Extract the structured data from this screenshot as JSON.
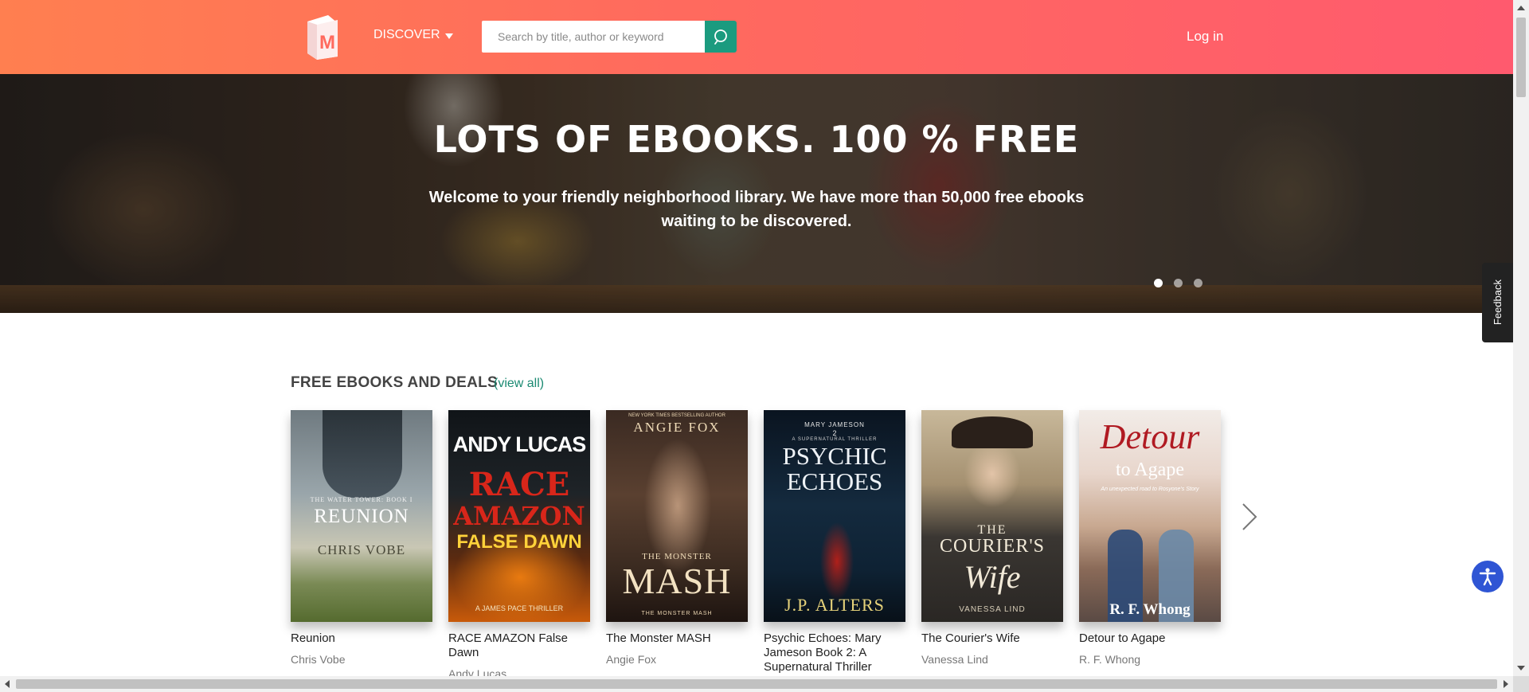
{
  "header": {
    "logo_letter": "M",
    "discover_label": "DISCOVER",
    "search_placeholder": "Search by title, author or keyword",
    "login_label": "Log in"
  },
  "hero": {
    "title": "LOTS OF EBOOKS. 100 % FREE",
    "subtitle": "Welcome to your friendly neighborhood library. We have more than 50,000 free ebooks waiting to be discovered.",
    "slides": 3,
    "active_slide": 1
  },
  "feedback_label": "Feedback",
  "section": {
    "title": "FREE EBOOKS AND DEALS",
    "view_all": "(view all)"
  },
  "books": [
    {
      "title": "Reunion",
      "author": "Chris Vobe",
      "cover": {
        "series": "THE WATER TOWER: BOOK I",
        "main": "REUNION",
        "author": "CHRIS VOBE"
      }
    },
    {
      "title": "RACE AMAZON False Dawn",
      "author": "Andy Lucas",
      "cover": {
        "author": "ANDY LUCAS",
        "line1": "RACE",
        "line2": "AMAZON",
        "line3": "FALSE DAWN",
        "tag": "A JAMES PACE THRILLER"
      }
    },
    {
      "title": "The Monster MASH",
      "author": "Angie Fox",
      "cover": {
        "top": "NEW YORK TIMES BESTSELLING AUTHOR",
        "author": "ANGIE FOX",
        "small": "THE MONSTER",
        "main": "MASH",
        "bottom": "THE MONSTER MASH"
      }
    },
    {
      "title": "Psychic Echoes: Mary Jameson Book 2: A Supernatural Thriller",
      "author": "",
      "cover": {
        "top": "MARY JAMESON",
        "num": "2",
        "sub": "A SUPERNATURAL THRILLER",
        "line1": "PSYCHIC",
        "line2": "ECHOES",
        "author": "J.P. ALTERS"
      }
    },
    {
      "title": "The Courier's Wife",
      "author": "Vanessa Lind",
      "cover": {
        "the": "THE",
        "line1": "COURIER'S",
        "line2": "Wife",
        "author": "VANESSA LIND"
      }
    },
    {
      "title": "Detour to Agape",
      "author": "R. F. Whong",
      "cover": {
        "line1": "Detour",
        "line2": "to Agape",
        "sub": "An unexpected road to Rosyone's Story",
        "author": "R. F. Whong"
      }
    }
  ],
  "colors": {
    "header_start": "#ff7f50",
    "header_end": "#ff5a6e",
    "accent": "#1b9b7f",
    "accessibility": "#2f55d4"
  }
}
